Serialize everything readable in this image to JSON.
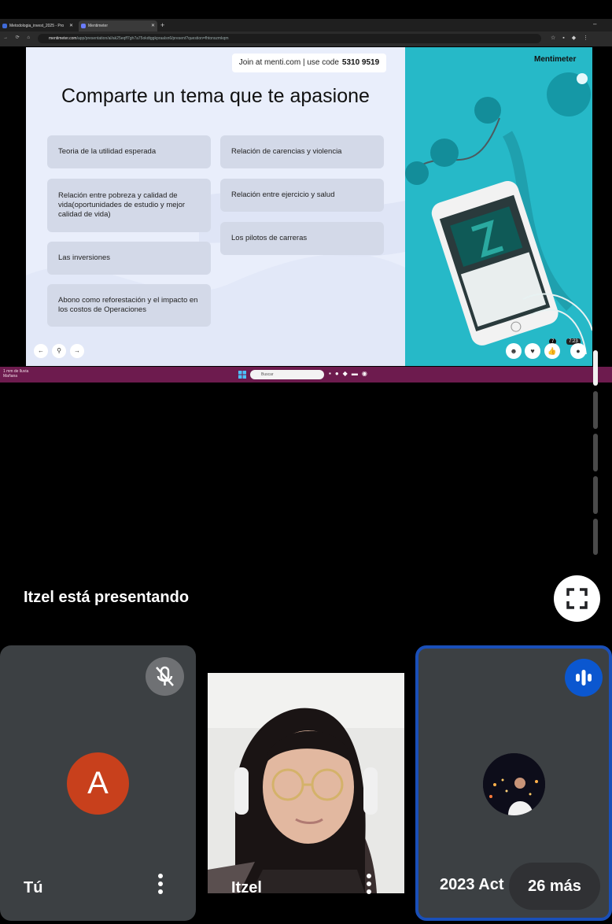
{
  "browser": {
    "tabs": [
      {
        "label": "Metodologia_invest_2025 - Pro"
      },
      {
        "label": "Mentimeter"
      }
    ],
    "new_tab": "+",
    "url_host": "mentimeter.com",
    "url_path": "/app/presentation/al/ak25eqff7gh7a75okdtggkpraalsn6/present?question=fhtonszmkqm"
  },
  "slide": {
    "join_text": "Join at menti.com | use code",
    "join_code": "5310 9519",
    "title": "Comparte un tema que te apasione",
    "cards": [
      "Teoria de la utilidad esperada",
      "Relación entre pobreza y calidad de vida(oportunidades de estudio y mejor calidad de vida)",
      "Las inversiones",
      "Abono como reforestación y el impacto en los costos de Operaciones",
      "Relación de carencias y violencia",
      "Relación entre ejercicio y salud",
      "Los pilotos de carreras"
    ],
    "brand": "Mentimeter",
    "participant_count": "7",
    "timer": "7:23"
  },
  "taskbar": {
    "weather_line1": "1 mm de lluvia",
    "weather_line2": "Mañana",
    "search_placeholder": "Buscar"
  },
  "meet": {
    "presenting_label": "Itzel está presentando",
    "more_people": "26 más",
    "participants": [
      {
        "name": "Tú",
        "initial": "A",
        "avatar_color": "#c8401c",
        "muted": true
      },
      {
        "name": "Itzel",
        "camera_on": true
      },
      {
        "name": "2023 Act",
        "speaking": true,
        "accent": "#0b57d0"
      }
    ]
  },
  "icons": {
    "fullscreen": "fullscreen-icon",
    "mic_off": "mic-off-icon",
    "speaking": "audio-level-icon",
    "more": "more-vert-icon"
  }
}
